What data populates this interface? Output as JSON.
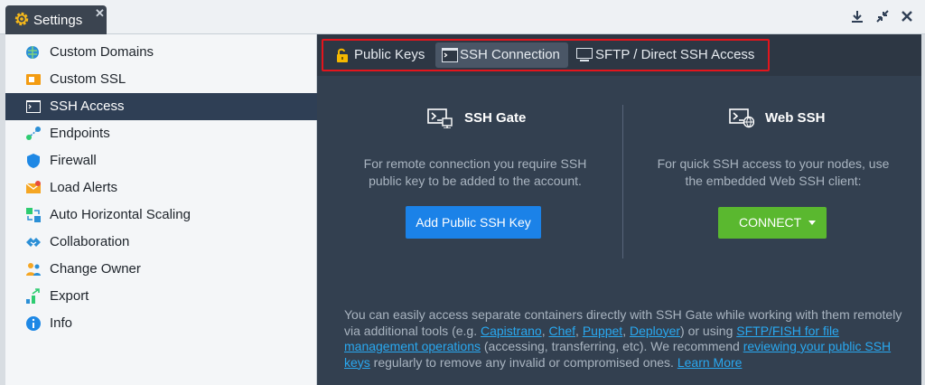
{
  "window": {
    "tab_title": "Settings",
    "close_glyph": "✕"
  },
  "sidebar": {
    "items": [
      {
        "label": "Custom Domains",
        "icon": "custom-domains-icon"
      },
      {
        "label": "Custom SSL",
        "icon": "custom-ssl-icon"
      },
      {
        "label": "SSH Access",
        "icon": "ssh-access-icon",
        "active": true
      },
      {
        "label": "Endpoints",
        "icon": "endpoints-icon"
      },
      {
        "label": "Firewall",
        "icon": "firewall-icon"
      },
      {
        "label": "Load Alerts",
        "icon": "load-alerts-icon"
      },
      {
        "label": "Auto Horizontal Scaling",
        "icon": "auto-scaling-icon"
      },
      {
        "label": "Collaboration",
        "icon": "collaboration-icon"
      },
      {
        "label": "Change Owner",
        "icon": "change-owner-icon"
      },
      {
        "label": "Export",
        "icon": "export-icon"
      },
      {
        "label": "Info",
        "icon": "info-icon"
      }
    ]
  },
  "tabs": [
    {
      "label": "Public Keys",
      "icon": "lock-icon"
    },
    {
      "label": "SSH Connection",
      "icon": "terminal-icon",
      "active": true
    },
    {
      "label": "SFTP / Direct SSH Access",
      "icon": "monitor-icon"
    }
  ],
  "ssh_gate": {
    "title": "SSH Gate",
    "desc_line1": "For remote connection you require SSH",
    "desc_line2": "public key to be added to the account.",
    "button": "Add Public SSH Key"
  },
  "web_ssh": {
    "title": "Web SSH",
    "desc_line1": "For quick SSH access to your nodes, use",
    "desc_line2": "the embedded Web SSH client:",
    "button": "CONNECT"
  },
  "footer": {
    "t1": "You can easily access separate containers directly with SSH Gate while working with them remotely via additional tools (e.g. ",
    "link_capistrano": "Capistrano",
    "sep1": ", ",
    "link_chef": "Chef",
    "sep2": ", ",
    "link_puppet": "Puppet",
    "sep3": ", ",
    "link_deployer": "Deployer",
    "t2": ") or using ",
    "link_sftp": "SFTP/FISH for file management operations",
    "t3": " (accessing, transferring, etc). We recommend ",
    "link_review": "reviewing your public SSH keys",
    "t4": " regularly to remove any invalid or compromised ones. ",
    "link_learn": "Learn More"
  },
  "colors": {
    "accent_blue": "#1b82e8",
    "connect_green": "#5ab82f",
    "highlight_red": "#e3151c",
    "link": "#29a8f0"
  }
}
